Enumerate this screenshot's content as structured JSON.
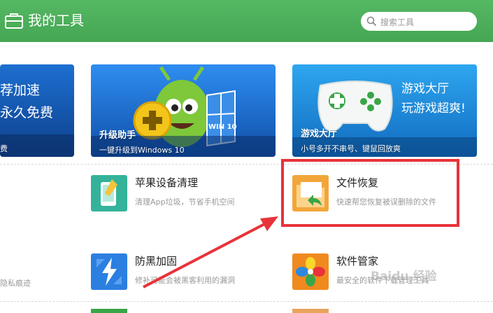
{
  "header": {
    "title": "我的工具",
    "search_placeholder": "搜索工具",
    "bg_color": "#4caf5b"
  },
  "banners": [
    {
      "slogan_line1": "荐加速",
      "slogan_line2": "永久免费",
      "sub": "费"
    },
    {
      "title": "升级助手",
      "sub": "一键升级到Windows 10",
      "badge": "WIN 10"
    },
    {
      "title": "游戏大厅",
      "sub": "小号多开不串号、键鼠回放爽",
      "slogan_line1": "游戏大厅",
      "slogan_line2": "玩游戏超爽!"
    }
  ],
  "tools": [
    {
      "name": "苹果设备清理",
      "desc": "清理App垃圾，节省手机空间",
      "icon": "phone-clean-icon"
    },
    {
      "name": "文件恢复",
      "desc": "快速帮您恢复被误删除的文件",
      "icon": "file-recovery-icon"
    },
    {
      "name": "防黑加固",
      "desc": "修补可能会被黑客利用的漏洞",
      "icon": "lightning-shield-icon"
    },
    {
      "name": "软件管家",
      "desc": "最安全的软件下载管理工具",
      "icon": "software-manager-icon"
    }
  ],
  "partial_left_text": "隐私痕迹",
  "watermark": "Baidu 经验",
  "colors": {
    "highlight": "#e8333a",
    "accent_green": "#4caf5b"
  }
}
